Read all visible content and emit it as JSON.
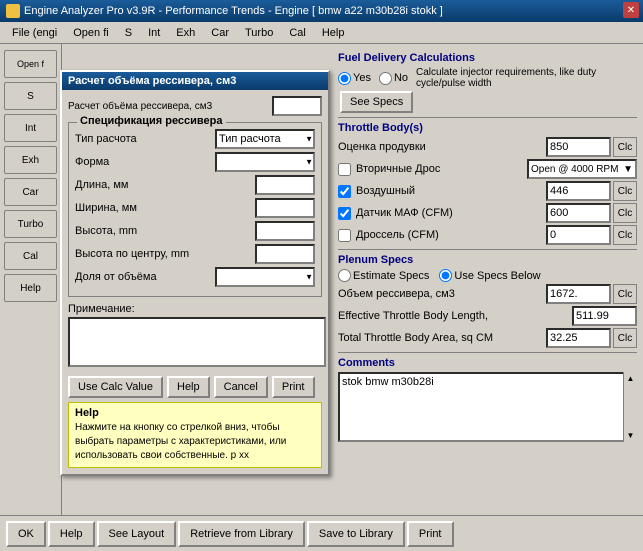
{
  "titlebar": {
    "title": "Engine Analyzer Pro v3.9R - Performance Trends - Engine [ bmw a22 m30b28i stokk ]",
    "icon": "engine-icon"
  },
  "menubar": {
    "items": [
      "File (engi",
      "Open fi",
      "S",
      "Int",
      "Exh",
      "Car",
      "Turbo",
      "Cal",
      "Help"
    ]
  },
  "popup": {
    "title": "Расчет объёма рессивера, см3",
    "top_label": "Расчет объёма рессивера, см3",
    "top_input": "",
    "groupbox_title": "Спецификация рессивера",
    "fields": {
      "type_label": "Тип расчота",
      "type_options": [
        "Тип расчота"
      ],
      "shape_label": "Форма",
      "shape_options": [
        ""
      ],
      "length_label": "Длина, мм",
      "width_label": "Ширина, мм",
      "height_label": "Высота, mm",
      "center_height_label": "Высота по центру, mm",
      "volume_share_label": "Доля от объёма"
    },
    "note_label": "Примечание:",
    "buttons": {
      "use_calc": "Use Calc Value",
      "help": "Help",
      "cancel": "Cancel",
      "print": "Print"
    },
    "help": {
      "title": "Help",
      "text": "Нажмите на кнопку со стрелкой вниз, чтобы выбрать параметры с характеристиками, или использовать свои собственные. р хх"
    }
  },
  "right_panel": {
    "fuel_delivery": {
      "header": "Fuel Delivery Calculations",
      "radio_yes": "Yes",
      "radio_no": "No",
      "description": "Calculate injector requirements, like duty cycle/pulse width",
      "see_specs_btn": "See Specs"
    },
    "throttle_body": {
      "header": "Throttle Body(s)",
      "oценка_label": "Оценка продувки",
      "oценка_value": "850",
      "secondary_label": "Вторичные Дрос",
      "secondary_dropdown": "Open @ 4000 RPM",
      "air_label": "Воздушный",
      "air_value": "446",
      "maf_label": "Датчик МАФ (CFM)",
      "maf_value": "600",
      "throttle_label": "Дроссель (CFM)",
      "throttle_value": "0",
      "clc": "Clc"
    },
    "plenum_specs": {
      "header": "Plenum Specs",
      "estimate_label": "Estimate Specs",
      "use_specs_label": "Use Specs Below",
      "volume_label": "Объем рессивера, см3",
      "volume_value": "1672.",
      "throttle_length_label": "Effective Throttle Body Length,",
      "throttle_length_value": "511.99",
      "throttle_area_label": "Total Throttle Body Area, sq CM",
      "throttle_area_value": "32.25",
      "clc": "Clc"
    },
    "comments": {
      "header": "Comments",
      "text": "stok bmw m30b28i"
    }
  },
  "bottom_bar": {
    "ok": "OK",
    "help": "Help",
    "see_layout": "See Layout",
    "retrieve_from_library": "Retrieve from Library",
    "save_to_library": "Save to Library",
    "print": "Print"
  },
  "sidebar": {
    "items": [
      "Open f",
      "S",
      "Int",
      "Exh",
      "Car",
      "Turbo",
      "Cal",
      "Help"
    ]
  }
}
